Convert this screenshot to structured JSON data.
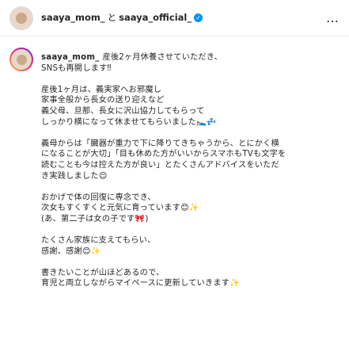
{
  "header": {
    "user1": "saaya_mom_",
    "conjunction": "と",
    "user2": "saaya_official_",
    "verified_icon": "✓",
    "more_icon": "…"
  },
  "post": {
    "author": "saaya_mom_",
    "paragraphs": [
      [
        "産後2ヶ月休養させていただき、",
        "SNSも再開します‼︎"
      ],
      [
        "産後1ヶ月は、義実家へお邪魔し",
        "家事全般から長女の送り迎えなど",
        "義父母、旦那、長女に沢山協力してもらって",
        "しっかり横になって休ませてもらいました🛌💤"
      ],
      [
        "義母からは「臓器が重力で下に降りてきちゃうから、とにかく横",
        "になることが大切」「目も休めた方がいいからスマホもTVも文字を",
        "読むことも今は控えた方が良い」とたくさんアドバイスをいただ",
        "き実践しました😌"
      ],
      [
        "おかげで体の回復に専念でき、",
        "次女もすくすくと元気に育っています😊✨",
        "(あ、第二子は女の子です🎀)"
      ],
      [
        "たくさん家族に支えてもらい、",
        "感謝、感謝😊✨"
      ],
      [
        "書きたいことが山ほどあるので、",
        "育児と両立しながらマイペースに更新していきます✨"
      ]
    ]
  }
}
